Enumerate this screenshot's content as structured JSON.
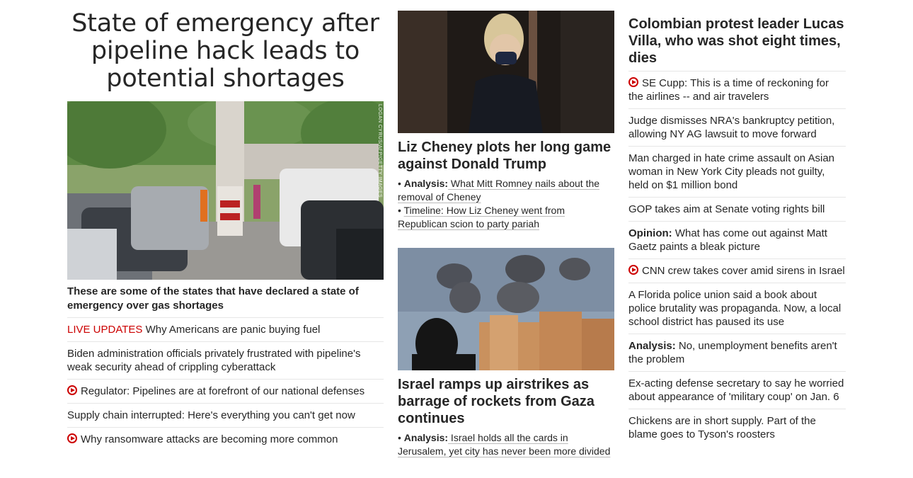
{
  "left": {
    "headline_lines": [
      "State of emergency after",
      "pipeline hack leads to",
      "potential shortages"
    ],
    "photo_credit": "LOGAN CYRUS/AFP/GETTY IMAGES",
    "lead_link": "These are some of the states that have declared a state of emergency over gas shortages",
    "items": [
      {
        "prefix": "LIVE UPDATES",
        "text": " Why Americans are panic buying fuel",
        "video": false
      },
      {
        "prefix": "",
        "text": "Biden administration officials privately frustrated with pipeline's weak security ahead of crippling cyberattack",
        "video": false
      },
      {
        "prefix": "",
        "text": "Regulator: Pipelines are at forefront of our national defenses",
        "video": true
      },
      {
        "prefix": "",
        "text": "Supply chain interrupted: Here's everything you can't get now",
        "video": false
      },
      {
        "prefix": "",
        "text": "Why ransomware attacks are becoming more common",
        "video": true
      }
    ]
  },
  "mid": {
    "story1": {
      "headline": "Liz Cheney plots her long game against Donald Trump",
      "links": [
        {
          "bold": "Analysis:",
          "text": " What Mitt Romney nails about the removal of Cheney"
        },
        {
          "bold": "",
          "text": "Timeline: How Liz Cheney went from Republican scion to party pariah"
        }
      ]
    },
    "story2": {
      "headline": "Israel ramps up airstrikes as barrage of rockets from Gaza continues",
      "links": [
        {
          "bold": "Analysis:",
          "text": " Israel holds all the cards in Jerusalem, yet city has never been more divided"
        }
      ]
    }
  },
  "right": {
    "headline": "Colombian protest leader Lucas Villa, who was shot eight times, dies",
    "items": [
      {
        "bold": "",
        "text": "SE Cupp: This is a time of reckoning for the airlines -- and air travelers",
        "video": true
      },
      {
        "bold": "",
        "text": "Judge dismisses NRA's bankruptcy petition, allowing NY AG lawsuit to move forward",
        "video": false
      },
      {
        "bold": "",
        "text": "Man charged in hate crime assault on Asian woman in New York City pleads not guilty, held on $1 million bond",
        "video": false
      },
      {
        "bold": "",
        "text": "GOP takes aim at Senate voting rights bill",
        "video": false
      },
      {
        "bold": "Opinion:",
        "text": " What has come out against Matt Gaetz paints a bleak picture",
        "video": false
      },
      {
        "bold": "",
        "text": "CNN crew takes cover amid sirens in Israel",
        "video": true
      },
      {
        "bold": "",
        "text": "A Florida police union said a book about police brutality was propaganda. Now, a local school district has paused its use",
        "video": false
      },
      {
        "bold": "Analysis:",
        "text": " No, unemployment benefits aren't the problem",
        "video": false
      },
      {
        "bold": "",
        "text": "Ex-acting defense secretary to say he worried about appearance of 'military coup' on Jan. 6",
        "video": false
      },
      {
        "bold": "",
        "text": "Chickens are in short supply. Part of the blame goes to Tyson's roosters",
        "video": false
      }
    ]
  },
  "colors": {
    "accent_red": "#cc0000",
    "text": "#262626",
    "divider": "#e6e6e6"
  }
}
